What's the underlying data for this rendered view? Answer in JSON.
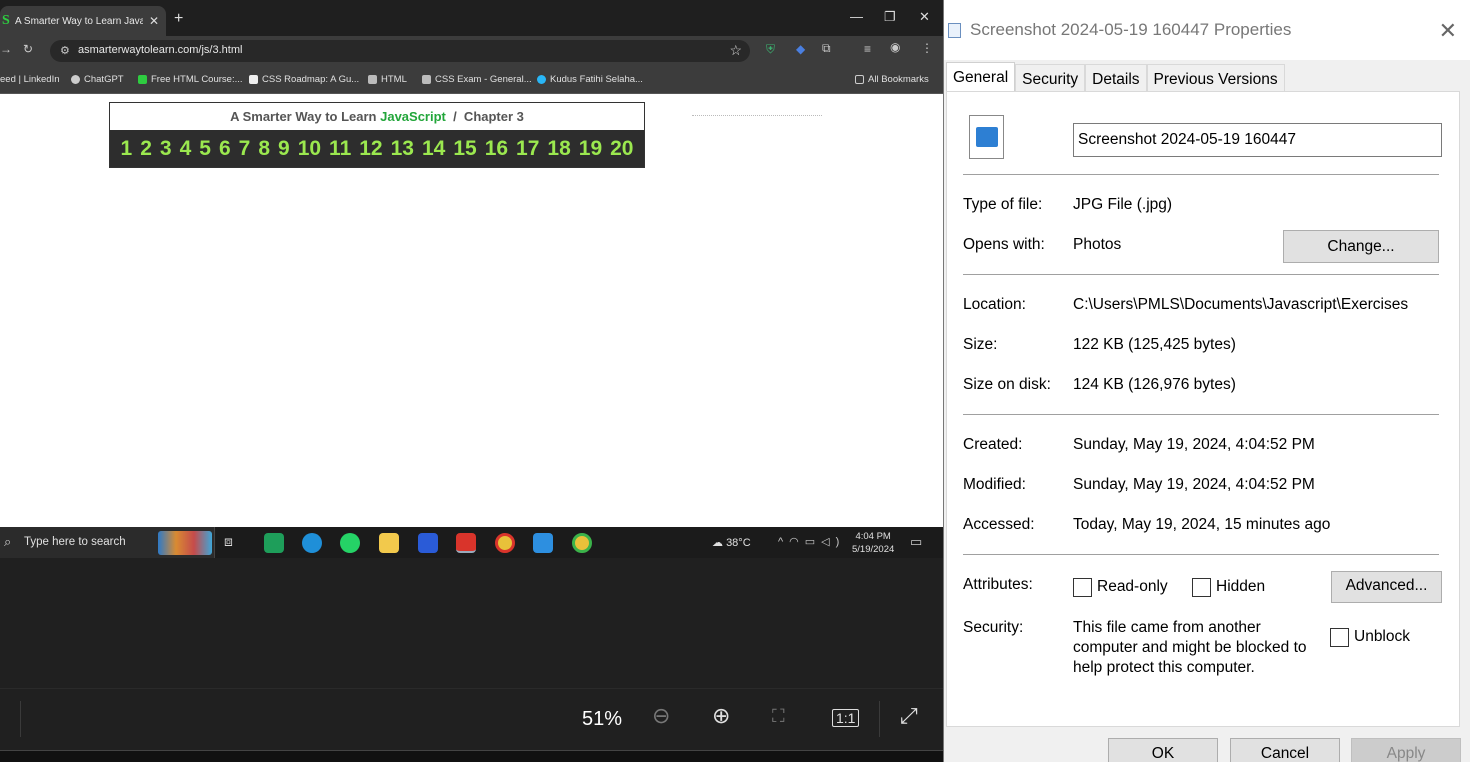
{
  "browser": {
    "tab_title": "A Smarter Way to Learn JavaScri",
    "url": "asmarterwaytolearn.com/js/3.html",
    "bookmarks": [
      "eed | LinkedIn",
      "ChatGPT",
      "Free HTML Course:...",
      "CSS Roadmap: A Gu...",
      "HTML",
      "CSS Exam - General...",
      "Kudus Fatihi Selaha...",
      "All Bookmarks"
    ]
  },
  "page": {
    "banner_prefix": "A Smarter Way to Learn ",
    "banner_js": "JavaScript",
    "banner_suffix": "  /  Chapter 3",
    "chapters": [
      "1",
      "2",
      "3",
      "4",
      "5",
      "6",
      "7",
      "8",
      "9",
      "10",
      "11",
      "12",
      "13",
      "14",
      "15",
      "16",
      "17",
      "18",
      "19",
      "20"
    ]
  },
  "taskbar": {
    "search_placeholder": "Type here to search",
    "weather": "38°C",
    "time": "4:04 PM",
    "date": "5/19/2024"
  },
  "viewer": {
    "zoom_level": "51%"
  },
  "dialog": {
    "title": "Screenshot 2024-05-19 160447 Properties",
    "tabs": [
      "General",
      "Security",
      "Details",
      "Previous Versions"
    ],
    "file_name": "Screenshot 2024-05-19 160447",
    "type_label": "Type of file:",
    "type_value": "JPG File (.jpg)",
    "opens_label": "Opens with:",
    "opens_value": "Photos",
    "change_btn": "Change...",
    "location_label": "Location:",
    "location_value": "C:\\Users\\PMLS\\Documents\\Javascript\\Exercises",
    "size_label": "Size:",
    "size_value": "122 KB (125,425 bytes)",
    "disk_label": "Size on disk:",
    "disk_value": "124 KB (126,976 bytes)",
    "created_label": "Created:",
    "created_value": "Sunday, May 19, 2024, 4:04:52 PM",
    "modified_label": "Modified:",
    "modified_value": "Sunday, May 19, 2024, 4:04:52 PM",
    "accessed_label": "Accessed:",
    "accessed_value": "Today, May 19, 2024, 15 minutes ago",
    "attributes_label": "Attributes:",
    "readonly_label": "Read-only",
    "hidden_label": "Hidden",
    "advanced_btn": "Advanced...",
    "security_label": "Security:",
    "security_msg": "This file came from another computer and might be blocked to help protect this computer.",
    "unblock_label": "Unblock",
    "ok_btn": "OK",
    "cancel_btn": "Cancel",
    "apply_btn": "Apply"
  }
}
